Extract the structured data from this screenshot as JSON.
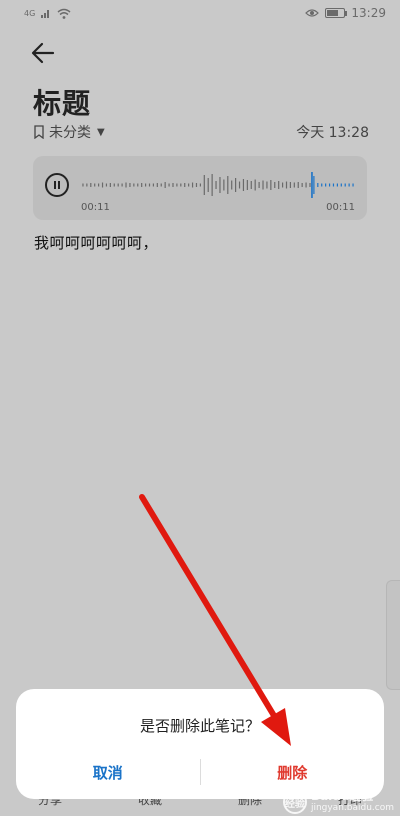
{
  "status_bar": {
    "signal": "4G",
    "time": "13:29",
    "battery_level": 0.7
  },
  "note": {
    "title": "标题",
    "category": "未分类",
    "datetime": "今天 13:28",
    "body": "我呵呵呵呵呵呵，"
  },
  "audio": {
    "elapsed": "00:11",
    "duration": "00:11",
    "progress": 0.84
  },
  "toolbar": {
    "items": [
      "分享",
      "收藏",
      "删除",
      "打印"
    ]
  },
  "dialog": {
    "message": "是否删除此笔记？",
    "cancel_label": "取消",
    "delete_label": "删除"
  },
  "colors": {
    "accent_blue": "#1a73c8",
    "delete_red": "#e03a2f",
    "annotation_red": "#e0190f"
  },
  "watermark": {
    "badge": "经验",
    "title": "Baidu经验",
    "subtitle": "jingyan.baidu.com"
  }
}
